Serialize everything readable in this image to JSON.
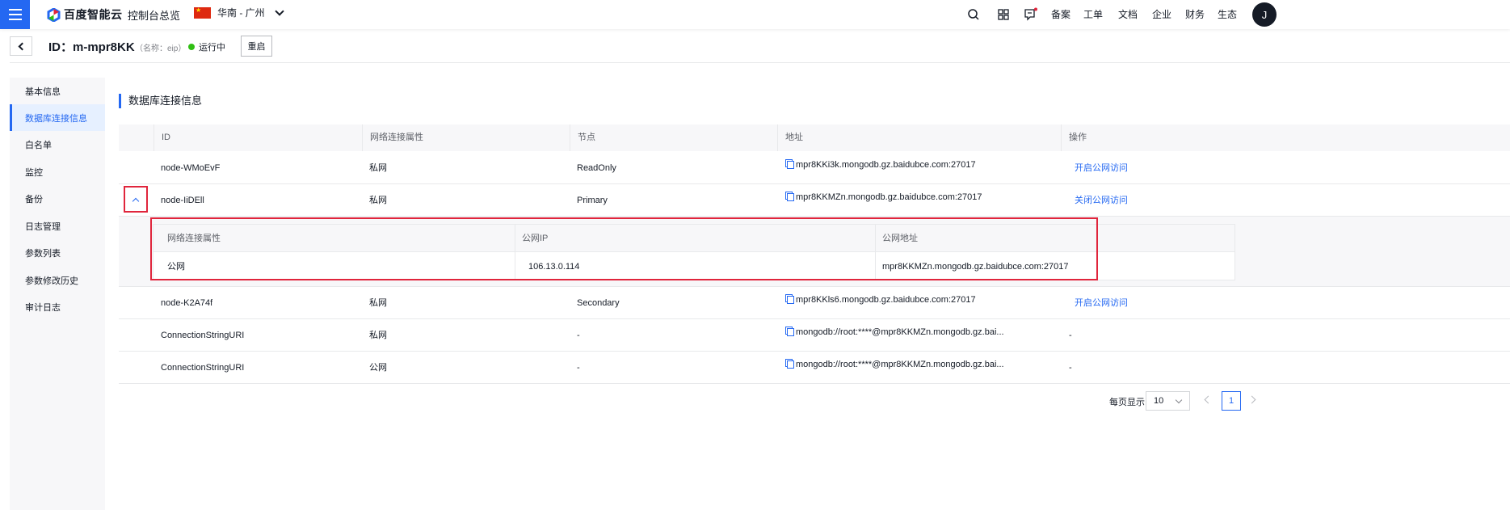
{
  "topbar": {
    "brand": "百度智能云",
    "console": "控制台总览",
    "region": "华南 - 广州",
    "nav": [
      "备案",
      "工单",
      "文档",
      "企业",
      "财务",
      "生态"
    ],
    "avatar_initial": "J"
  },
  "header": {
    "instance_id": "ID：m-mpr8KK",
    "instance_name": "（名称：eip）",
    "status": "运行中",
    "restart_label": "重启"
  },
  "sidebar": {
    "items": [
      {
        "label": "基本信息",
        "active": false
      },
      {
        "label": "数据库连接信息",
        "active": true
      },
      {
        "label": "白名单",
        "active": false
      },
      {
        "label": "监控",
        "active": false
      },
      {
        "label": "备份",
        "active": false
      },
      {
        "label": "日志管理",
        "active": false
      },
      {
        "label": "参数列表",
        "active": false
      },
      {
        "label": "参数修改历史",
        "active": false
      },
      {
        "label": "审计日志",
        "active": false
      }
    ]
  },
  "section": {
    "title": "数据库连接信息"
  },
  "table": {
    "headers": [
      "ID",
      "网络连接属性",
      "节点",
      "地址",
      "操作"
    ],
    "rows": [
      {
        "id": "node-WMoEvF",
        "network": "私网",
        "node": "ReadOnly",
        "address": "mpr8KKi3k.mongodb.gz.baidubce.com:27017",
        "action": "开启公网访问"
      },
      {
        "id": "node-IiDEll",
        "network": "私网",
        "node": "Primary",
        "address": "mpr8KKMZn.mongodb.gz.baidubce.com:27017",
        "action": "关闭公网访问"
      },
      {
        "id": "node-K2A74f",
        "network": "私网",
        "node": "Secondary",
        "address": "mpr8KKls6.mongodb.gz.baidubce.com:27017",
        "action": "开启公网访问"
      },
      {
        "id": "ConnectionStringURI",
        "network": "私网",
        "node": "-",
        "address": "mongodb://root:****@mpr8KKMZn.mongodb.gz.bai...",
        "action": "-"
      },
      {
        "id": "ConnectionStringURI",
        "network": "公网",
        "node": "-",
        "address": "mongodb://root:****@mpr8KKMZn.mongodb.gz.bai...",
        "action": "-"
      }
    ]
  },
  "expanded": {
    "headers": [
      "网络连接属性",
      "公网IP",
      "公网地址"
    ],
    "row": {
      "network": "公网",
      "ip": "106.13.0.114",
      "address": "mpr8KKMZn.mongodb.gz.baidubce.com:27017"
    }
  },
  "pagination": {
    "label": "每页显示",
    "page_size": "10",
    "current_page": "1"
  },
  "colors": {
    "primary": "#2468f2",
    "highlight": "#e0253c",
    "status_green": "#30bf13"
  }
}
